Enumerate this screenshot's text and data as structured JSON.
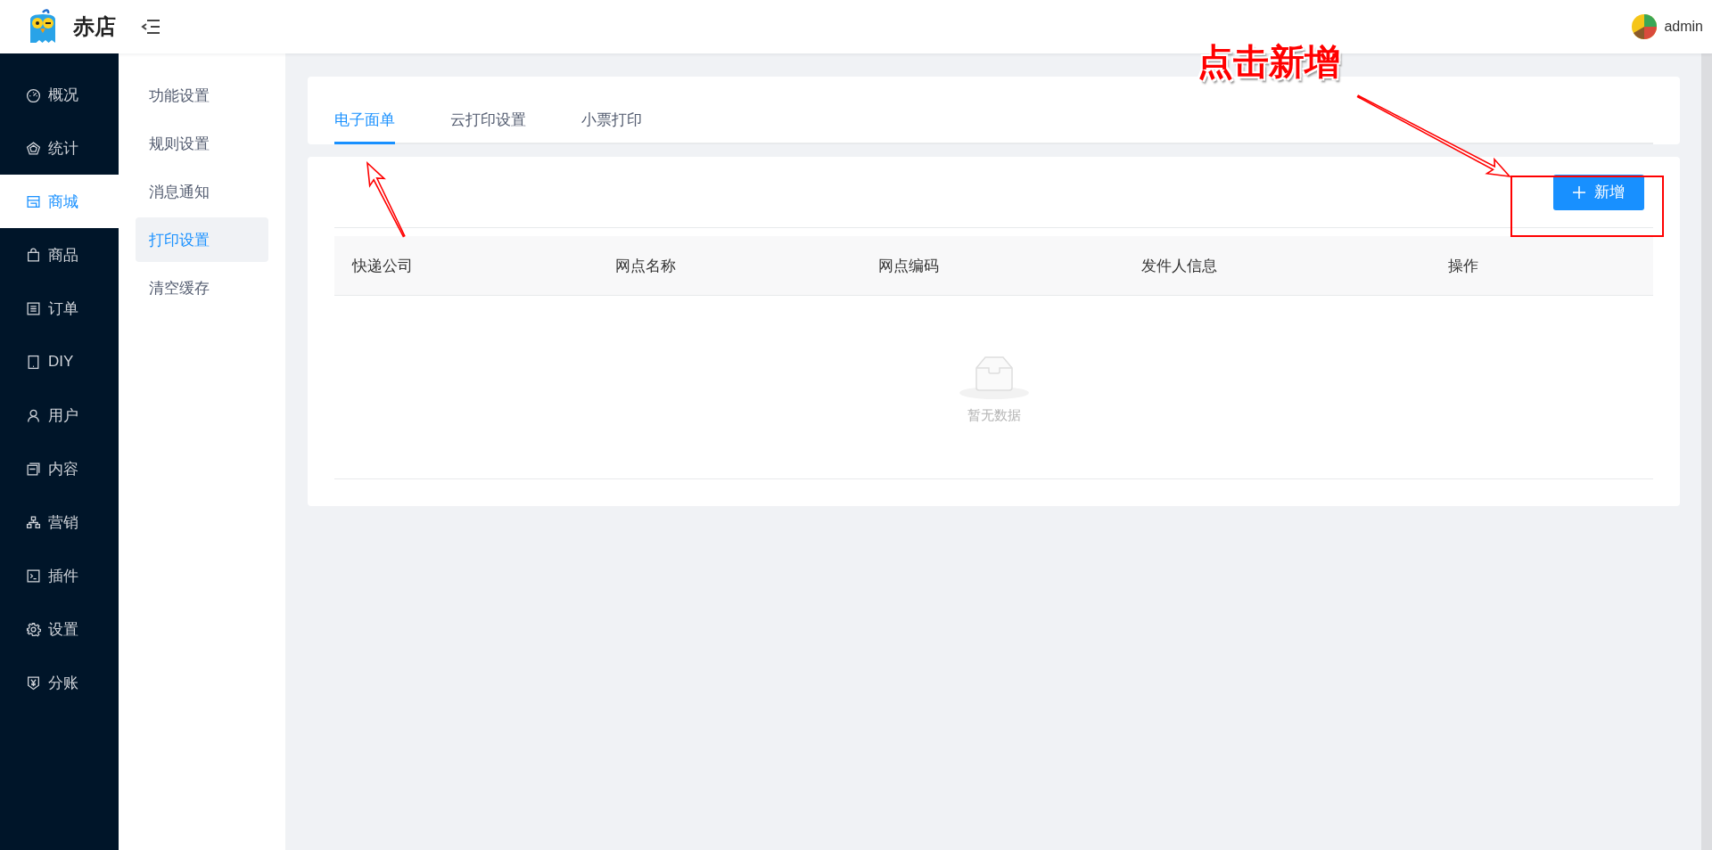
{
  "header": {
    "brand": "赤店",
    "user": "admin"
  },
  "sidebar": {
    "items": [
      {
        "label": "概况",
        "selected": false
      },
      {
        "label": "统计",
        "selected": false
      },
      {
        "label": "商城",
        "selected": true
      },
      {
        "label": "商品",
        "selected": false
      },
      {
        "label": "订单",
        "selected": false
      },
      {
        "label": "DIY",
        "selected": false
      },
      {
        "label": "用户",
        "selected": false
      },
      {
        "label": "内容",
        "selected": false
      },
      {
        "label": "营销",
        "selected": false
      },
      {
        "label": "插件",
        "selected": false
      },
      {
        "label": "设置",
        "selected": false
      },
      {
        "label": "分账",
        "selected": false
      }
    ]
  },
  "submenu": {
    "items": [
      {
        "label": "功能设置",
        "selected": false
      },
      {
        "label": "规则设置",
        "selected": false
      },
      {
        "label": "消息通知",
        "selected": false
      },
      {
        "label": "打印设置",
        "selected": true
      },
      {
        "label": "清空缓存",
        "selected": false
      }
    ]
  },
  "tabs": [
    {
      "label": "电子面单",
      "selected": true
    },
    {
      "label": "云打印设置",
      "selected": false
    },
    {
      "label": "小票打印",
      "selected": false
    }
  ],
  "toolbar": {
    "add_button": "新增"
  },
  "table": {
    "columns": [
      "快递公司",
      "网点名称",
      "网点编码",
      "发件人信息",
      "操作"
    ],
    "empty_text": "暂无数据"
  },
  "annotation": {
    "callout": "点击新增"
  }
}
